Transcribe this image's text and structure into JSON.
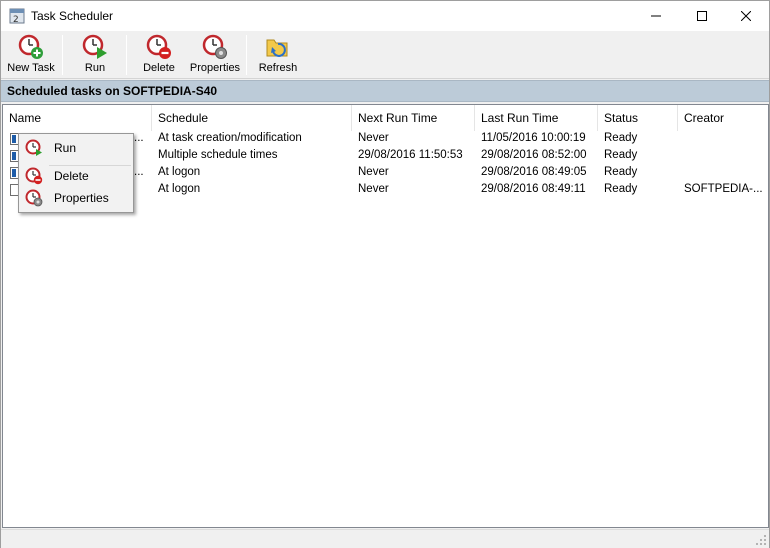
{
  "window": {
    "title": "Task Scheduler"
  },
  "toolbar": {
    "new_task": "New Task",
    "run": "Run",
    "delete": "Delete",
    "properties": "Properties",
    "refresh": "Refresh"
  },
  "band": {
    "title": "Scheduled tasks on SOFTPEDIA-S40"
  },
  "columns": [
    "Name",
    "Schedule",
    "Next Run Time",
    "Last Run Time",
    "Status",
    "Creator"
  ],
  "rows": [
    {
      "checked": true,
      "name_suffix": "...",
      "schedule": "At task creation/modification",
      "next_run": "Never",
      "last_run": "11/05/2016 10:00:19",
      "status": "Ready",
      "creator": ""
    },
    {
      "checked": true,
      "name_suffix": "",
      "schedule": "Multiple schedule times",
      "next_run": "29/08/2016 11:50:53",
      "last_run": "29/08/2016 08:52:00",
      "status": "Ready",
      "creator": ""
    },
    {
      "checked": true,
      "name_suffix": "...",
      "schedule": "At logon",
      "next_run": "Never",
      "last_run": "29/08/2016 08:49:05",
      "status": "Ready",
      "creator": ""
    },
    {
      "checked": false,
      "name_suffix": "",
      "schedule": "At logon",
      "next_run": "Never",
      "last_run": "29/08/2016 08:49:11",
      "status": "Ready",
      "creator": "SOFTPEDIA-..."
    }
  ],
  "context_menu": {
    "run": "Run",
    "delete": "Delete",
    "properties": "Properties"
  },
  "icons": {
    "app": "task-scheduler-icon",
    "new_task": "clock-plus-icon",
    "run": "clock-play-icon",
    "delete": "clock-delete-icon",
    "properties": "clock-gear-icon",
    "refresh": "folder-refresh-icon"
  },
  "colors": {
    "band": "#bccbd8",
    "clock_red": "#c0282d",
    "add_green": "#2f9e3a",
    "play_green": "#2e9e2e"
  }
}
